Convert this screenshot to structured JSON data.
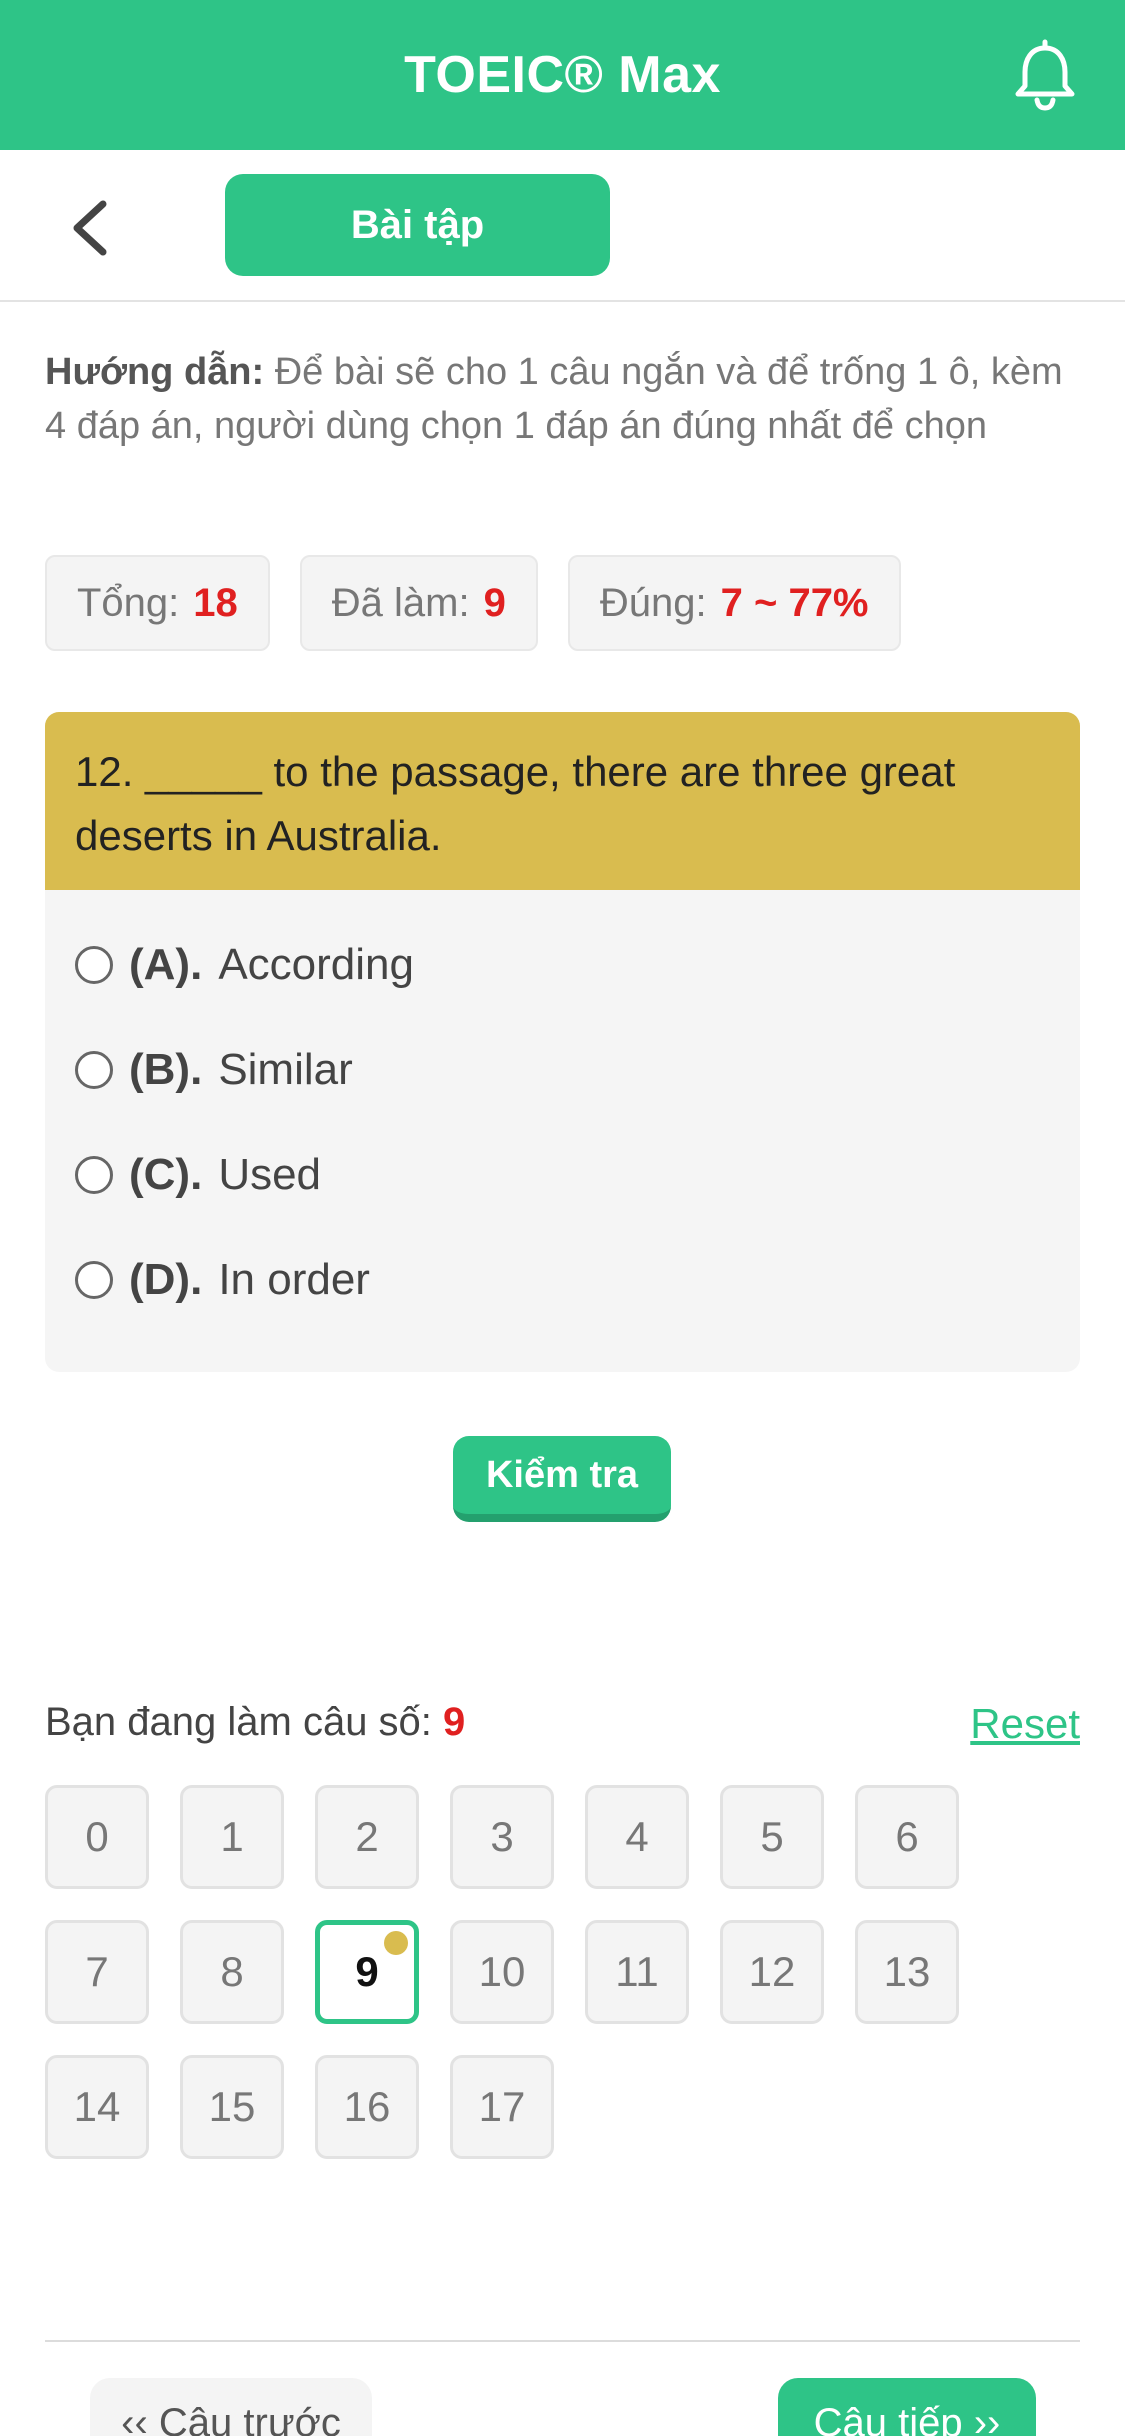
{
  "header": {
    "title": "TOEIC® Max",
    "bell_icon": "bell-icon"
  },
  "nav": {
    "back_icon": "chevron-left-icon",
    "tab_label": "Bài tập"
  },
  "instructions": {
    "label": "Hướng dẫn:",
    "text": "Để bài sẽ cho 1 câu ngắn và để trống 1 ô, kèm 4 đáp án, người dùng chọn 1 đáp án đúng nhất để chọn"
  },
  "stats": [
    {
      "label": "Tổng:",
      "value": "18"
    },
    {
      "label": "Đã làm:",
      "value": "9"
    },
    {
      "label": "Đúng:",
      "value": "7 ~ 77%"
    }
  ],
  "question": {
    "text": "12. _____ to the passage, there are three great deserts in Australia.",
    "options": [
      {
        "key": "(A).",
        "text": "According"
      },
      {
        "key": "(B).",
        "text": "Similar"
      },
      {
        "key": "(C).",
        "text": "Used"
      },
      {
        "key": "(D).",
        "text": "In order"
      }
    ]
  },
  "check_button": "Kiểm tra",
  "progress": {
    "label": "Bạn đang làm câu số:",
    "current": "9",
    "reset": "Reset"
  },
  "numbers": [
    "0",
    "1",
    "2",
    "3",
    "4",
    "5",
    "6",
    "7",
    "8",
    "9",
    "10",
    "11",
    "12",
    "13",
    "14",
    "15",
    "16",
    "17"
  ],
  "active_number": "9",
  "footer": {
    "prev": "‹‹ Câu trước",
    "next": "Câu tiếp ››"
  },
  "colors": {
    "brand": "#2ec487",
    "question_header": "#d9bc4f",
    "highlight_red": "#e02020"
  }
}
